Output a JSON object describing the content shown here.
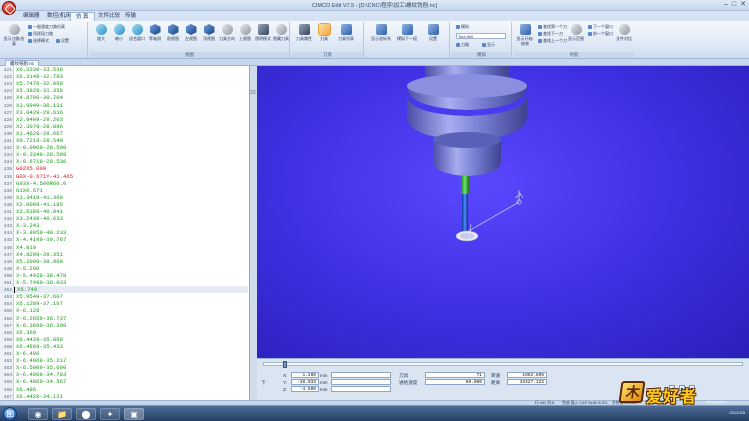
{
  "window": {
    "title": "CIMCO Edit V7.5 - [D:\\CNC\\程序\\加工\\螺纹铣削.nc]",
    "controls": [
      "–",
      "□",
      "✕"
    ]
  },
  "ribbon_tabs": [
    {
      "label": "编辑器"
    },
    {
      "label": "数控(机床)代"
    },
    {
      "label": "仿 真"
    },
    {
      "label": "文件比较"
    },
    {
      "label": "传输"
    }
  ],
  "ribbon": {
    "group1": {
      "label": "",
      "large": "显示刀路/仿真",
      "small": [
        "用逐段刀路",
        "选择模式",
        "设置"
      ],
      "small_top": "一般速度刀路仿真"
    },
    "view_group": {
      "label": "视图",
      "buttons": [
        "放大",
        "缩小",
        "适合窗口",
        "等轴测",
        "前视图",
        "左视图",
        "顶视图",
        "刀具方向",
        "上视图",
        "透明模式",
        "隐藏刀具"
      ]
    },
    "tool_group": {
      "label": "刀具",
      "buttons": [
        "刀具属性",
        "刀具",
        "刀具列表"
      ]
    },
    "sim_group": {
      "label": "",
      "buttons": [
        "显示坐标系",
        "模拟下一段",
        "设置"
      ]
    },
    "option_group": {
      "label": "模拟",
      "combo": "Tool drill",
      "small": [
        "模拟",
        "刀路",
        "显示"
      ]
    },
    "nav_group": {
      "label": "导航",
      "small": [
        "查找第一个刀",
        "查找下一刀",
        "查找上一个刀",
        "下一个窗口",
        "前一个窗口"
      ],
      "large": [
        "显示开始/结束",
        "显示范围",
        "文件对比"
      ]
    }
  },
  "document_tab": "螺纹铣削.nc",
  "editor": {
    "lines": [
      {
        "no": "421",
        "code": "X6.3339-33.538",
        "kind": "coord"
      },
      {
        "no": "422",
        "code": "X6.3148-32.793",
        "kind": "coord"
      },
      {
        "no": "423",
        "code": "X5.7479-32.060",
        "kind": "coord"
      },
      {
        "no": "424",
        "code": "X5.3829-31.358",
        "kind": "coord"
      },
      {
        "no": "425",
        "code": "X4.8799-30.704",
        "kind": "coord"
      },
      {
        "no": "426",
        "code": "X3.9949-30.131",
        "kind": "coord"
      },
      {
        "no": "427",
        "code": "X3.0429-29.616",
        "kind": "coord"
      },
      {
        "no": "428",
        "code": "X2.9409-29.203",
        "kind": "coord"
      },
      {
        "no": "429",
        "code": "X2.3079-28.886",
        "kind": "coord"
      },
      {
        "no": "430",
        "code": "X1.4629-28.667",
        "kind": "coord"
      },
      {
        "no": "431",
        "code": "X0.7219-28.540",
        "kind": "coord"
      },
      {
        "no": "432",
        "code": "X-0.0009-28.500",
        "kind": "coord"
      },
      {
        "no": "433",
        "code": "X-0.3349-28.509",
        "kind": "coord"
      },
      {
        "no": "434",
        "code": "X-0.6719-28.536",
        "kind": "coord"
      },
      {
        "no": "435",
        "code": "G02X5.000",
        "kind": "cmd"
      },
      {
        "no": "436",
        "code": "G0X-0.671Y-41.465",
        "kind": "cmd"
      },
      {
        "no": "437",
        "code": "G03X-4.500R60.0",
        "kind": "coord"
      },
      {
        "no": "438",
        "code": "G1X0.671",
        "kind": "coord"
      },
      {
        "no": "439",
        "code": "X1.3419-41.369",
        "kind": "coord"
      },
      {
        "no": "440",
        "code": "X2.0009-41.185",
        "kind": "coord"
      },
      {
        "no": "441",
        "code": "X2.6389-40.941",
        "kind": "coord"
      },
      {
        "no": "442",
        "code": "X3.2439-40.633",
        "kind": "coord"
      },
      {
        "no": "443",
        "code": "X-3.243",
        "kind": "coord"
      },
      {
        "no": "444",
        "code": "X-3.8059-40.233",
        "kind": "coord"
      },
      {
        "no": "445",
        "code": "X-4.4199-39.767",
        "kind": "coord"
      },
      {
        "no": "446",
        "code": "X4.819",
        "kind": "coord"
      },
      {
        "no": "447",
        "code": "X4.8299-39.351",
        "kind": "coord"
      },
      {
        "no": "448",
        "code": "X5.2009-38.900",
        "kind": "coord"
      },
      {
        "no": "449",
        "code": "X-5.200",
        "kind": "coord"
      },
      {
        "no": "450",
        "code": "X-5.4929-38.478",
        "kind": "coord"
      },
      {
        "no": "451",
        "code": "X-5.7499-38.033",
        "kind": "coord"
      },
      {
        "no": "452",
        "code": "X5.749",
        "kind": "cur"
      },
      {
        "no": "453",
        "code": "X5.9549-37.607",
        "kind": "coord"
      },
      {
        "no": "454",
        "code": "X6.1289-37.167",
        "kind": "coord"
      },
      {
        "no": "455",
        "code": "X-6.128",
        "kind": "coord"
      },
      {
        "no": "456",
        "code": "X-6.2659-36.737",
        "kind": "coord"
      },
      {
        "no": "457",
        "code": "X-6.3699-36.300",
        "kind": "coord"
      },
      {
        "no": "458",
        "code": "X6.369",
        "kind": "coord"
      },
      {
        "no": "459",
        "code": "X6.4429-35.869",
        "kind": "coord"
      },
      {
        "no": "460",
        "code": "X6.4869-35.433",
        "kind": "coord"
      },
      {
        "no": "461",
        "code": "X-6.486",
        "kind": "coord"
      },
      {
        "no": "462",
        "code": "X-6.4969-35.217",
        "kind": "coord"
      },
      {
        "no": "463",
        "code": "X-6.5009-35.000",
        "kind": "coord"
      },
      {
        "no": "464",
        "code": "X-6.4969-34.783",
        "kind": "coord"
      },
      {
        "no": "465",
        "code": "X-6.4869-34.567",
        "kind": "coord"
      },
      {
        "no": "466",
        "code": "X6.486",
        "kind": "coord"
      },
      {
        "no": "467",
        "code": "X6.4429-34.131",
        "kind": "coord"
      }
    ],
    "side_number": "23"
  },
  "readout": {
    "x_label": "X:",
    "x_value": "1.260",
    "y_label": "Y:",
    "y_value": "-38.033",
    "z_label": "Z:",
    "z_value": "-4.500",
    "unit": "mm",
    "tool_label": "刀具",
    "tool_value": "T1",
    "feed_label": "进给速度",
    "feed_value": "60.000",
    "spindle_label": "转速",
    "spindle_value": "1092.80%",
    "dist_label": "距离",
    "dist_value": "33427.123",
    "side_label": "下",
    "progress": 0.04
  },
  "status": {
    "left": "",
    "right1": "行:452 列:6",
    "right2": "完成  插入  CAP  NUM  SCRL",
    "right3": "字符数:123459"
  },
  "taskbar": {
    "items": [
      "◉",
      "📁",
      "⬤",
      "✦",
      "▣"
    ],
    "clock": "2012/3/8"
  },
  "watermark": {
    "main": "爱好者",
    "sub": "mfcao.com"
  },
  "colors": {
    "code_green": "#1b9a1b",
    "code_red": "#d01818",
    "viewport_blue": "#3c2fe0",
    "tool_body": "#6c74c8"
  }
}
